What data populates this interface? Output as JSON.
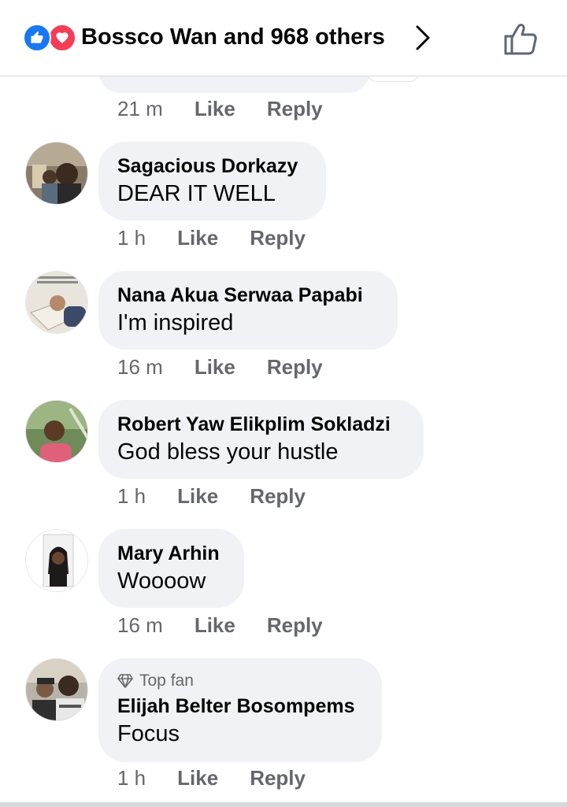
{
  "header": {
    "title": "Bossco Wan and 968 others",
    "reaction_icons": [
      "like-reaction-icon",
      "love-reaction-icon"
    ],
    "like_button_icon": "thumbs-up-outline-icon"
  },
  "colors": {
    "like_blue": "#1877f2",
    "love_red": "#f33e58",
    "bubble_bg": "#f0f2f5",
    "meta_gray": "#65676b"
  },
  "partial_comment": {
    "time": "21 m",
    "like_label": "Like",
    "reply_label": "Reply"
  },
  "comments": [
    {
      "author": "Sagacious Dorkazy",
      "text": "DEAR IT WELL",
      "time": "1 h",
      "like_label": "Like",
      "reply_label": "Reply"
    },
    {
      "author": "Nana Akua Serwaa Papabi",
      "text": "I'm inspired",
      "time": "16 m",
      "like_label": "Like",
      "reply_label": "Reply"
    },
    {
      "author": "Robert Yaw Elikplim Sokladzi",
      "text": "God bless your hustle",
      "time": "1 h",
      "like_label": "Like",
      "reply_label": "Reply"
    },
    {
      "author": "Mary Arhin",
      "text": "Woooow",
      "time": "16 m",
      "like_label": "Like",
      "reply_label": "Reply"
    },
    {
      "badge": "Top fan",
      "author": "Elijah Belter Bosompems",
      "text": "Focus",
      "time": "1 h",
      "like_label": "Like",
      "reply_label": "Reply"
    }
  ]
}
